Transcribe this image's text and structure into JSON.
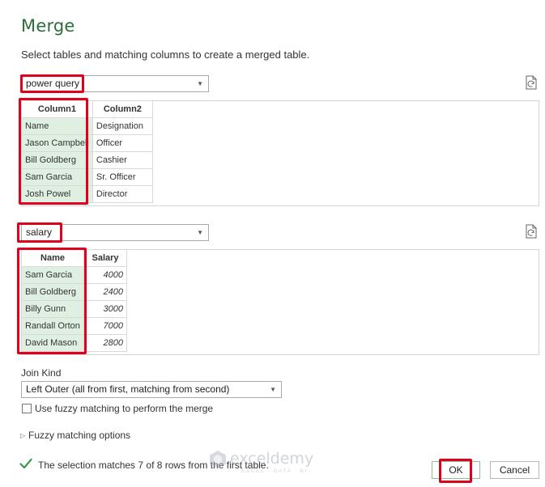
{
  "dialog": {
    "title": "Merge",
    "subtitle": "Select tables and matching columns to create a merged table."
  },
  "first_table": {
    "selected": "power query",
    "columns": [
      "Column1",
      "Column2"
    ],
    "rows": [
      [
        "Name",
        "Designation"
      ],
      [
        "Jason Campbell",
        "Officer"
      ],
      [
        "Bill Goldberg",
        "Cashier"
      ],
      [
        "Sam Garcia",
        "Sr. Officer"
      ],
      [
        "Josh Powel",
        "Director"
      ]
    ]
  },
  "second_table": {
    "selected": "salary",
    "columns": [
      "Name",
      "Salary"
    ],
    "rows": [
      [
        "Sam Garcia",
        "4000"
      ],
      [
        "Bill Goldberg",
        "2400"
      ],
      [
        "Billy Gunn",
        "3000"
      ],
      [
        "Randall Orton",
        "7000"
      ],
      [
        "David Mason",
        "2800"
      ]
    ]
  },
  "join": {
    "label": "Join Kind",
    "selected": "Left Outer (all from first, matching from second)",
    "fuzzy_checkbox_label": "Use fuzzy matching to perform the merge",
    "fuzzy_checked": false,
    "fuzzy_options_label": "Fuzzy matching options"
  },
  "status": {
    "text": "The selection matches 7 of 8 rows from the first table.",
    "icon": "checkmark-icon",
    "color": "#3a9a4a"
  },
  "buttons": {
    "ok": "OK",
    "cancel": "Cancel"
  },
  "watermark": {
    "name": "exceldemy",
    "tagline": "EXCEL · DATA · BI"
  },
  "colors": {
    "title": "#2d6e3a",
    "selected_column": "#dff0e2",
    "selected_header": "#8fc99d",
    "highlight_box": "#e0001b"
  }
}
